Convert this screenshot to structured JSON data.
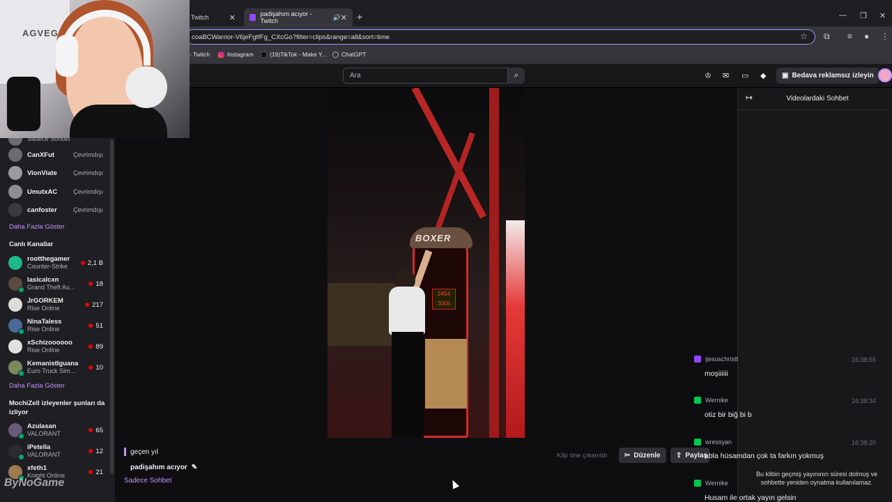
{
  "browser": {
    "tabs": [
      {
        "label": "Twitch"
      },
      {
        "label": "padişahım acıyor - Twitch"
      }
    ],
    "url": "coaBCWarrior-V6jeFgtfFg_CXcGo?filter=clips&range=all&sort=time",
    "bookmarks": [
      "- Twitch",
      "Instagram",
      "(19)TikTok - Make Y...",
      "ChatGPT"
    ]
  },
  "topnav": {
    "search_placeholder": "Ara",
    "adfree_label": "Bedava reklamsız izleyin"
  },
  "sidebar": {
    "partial_label": "Sadece Sohbet",
    "offline_channels": [
      {
        "name": "CanXFut",
        "status": "Çevrimdışı"
      },
      {
        "name": "VionViate",
        "status": "Çevrimdışı"
      },
      {
        "name": "UmutxAC",
        "status": "Çevrimdışı"
      },
      {
        "name": "canfoster",
        "status": "Çevrimdışı"
      }
    ],
    "show_more_1": "Daha Fazla Göster",
    "live_header": "Canlı Kanallar",
    "live_channels": [
      {
        "name": "rootthegamer",
        "game": "Counter-Strike",
        "viewers": "2,1 B"
      },
      {
        "name": "lasicalcxn",
        "game": "Grand Theft Au...",
        "viewers": "18"
      },
      {
        "name": "JrGORKEM",
        "game": "Rise Online",
        "viewers": "217"
      },
      {
        "name": "NinaTaless",
        "game": "Rise Online",
        "viewers": "51"
      },
      {
        "name": "xSchizoooooo",
        "game": "Rise Online",
        "viewers": "89"
      },
      {
        "name": "KemanistIguana",
        "game": "Euro Truck Sim...",
        "viewers": "10"
      }
    ],
    "show_more_2": "Daha Fazla Göster",
    "rec_header": "MochiZell izleyenler şunları da izliyor",
    "rec_channels": [
      {
        "name": "Azulasan",
        "game": "VALORANT",
        "viewers": "65"
      },
      {
        "name": "iPetella",
        "game": "VALORANT",
        "viewers": "12"
      },
      {
        "name": "xfeth1",
        "game": "Knight Online",
        "viewers": "21"
      }
    ]
  },
  "webcam": {
    "chair_brand": "AGVEGA"
  },
  "video": {
    "machine_label": "BOXER",
    "score_top": "2454",
    "score_bottom": "3005"
  },
  "clip": {
    "date": "geçen yıl",
    "title": "padişahım acıyor",
    "category": "Sadece Sohbet",
    "feature_label": "Klip öne çıkanıldı",
    "edit_label": "Düzenle",
    "share_label": "Paylaş"
  },
  "chat": {
    "title": "Videolardaki Sohbet",
    "messages": [
      {
        "user": "ijesuschristt",
        "time": "16:38:55",
        "text": "moşiiiiii",
        "color": "#9147ff"
      },
      {
        "user": "Wernike",
        "time": "16:38:34",
        "text": "otiz bir biğ bi b",
        "color": "#00c853"
      },
      {
        "user": "wressyan",
        "time": "16:38:20",
        "text": "abla hüsamdan çok ta farkın yokmuş",
        "color": "#00c853"
      },
      {
        "user": "Wernike",
        "time": "",
        "text": "Husam ile ortak yayın gelsin",
        "color": "#00c853"
      }
    ],
    "notice": "Bu klibin geçmiş yayınının süresi dolmuş ve sohbette yeniden oynatma kullanılamaz."
  },
  "watermark": "ByNoGame"
}
